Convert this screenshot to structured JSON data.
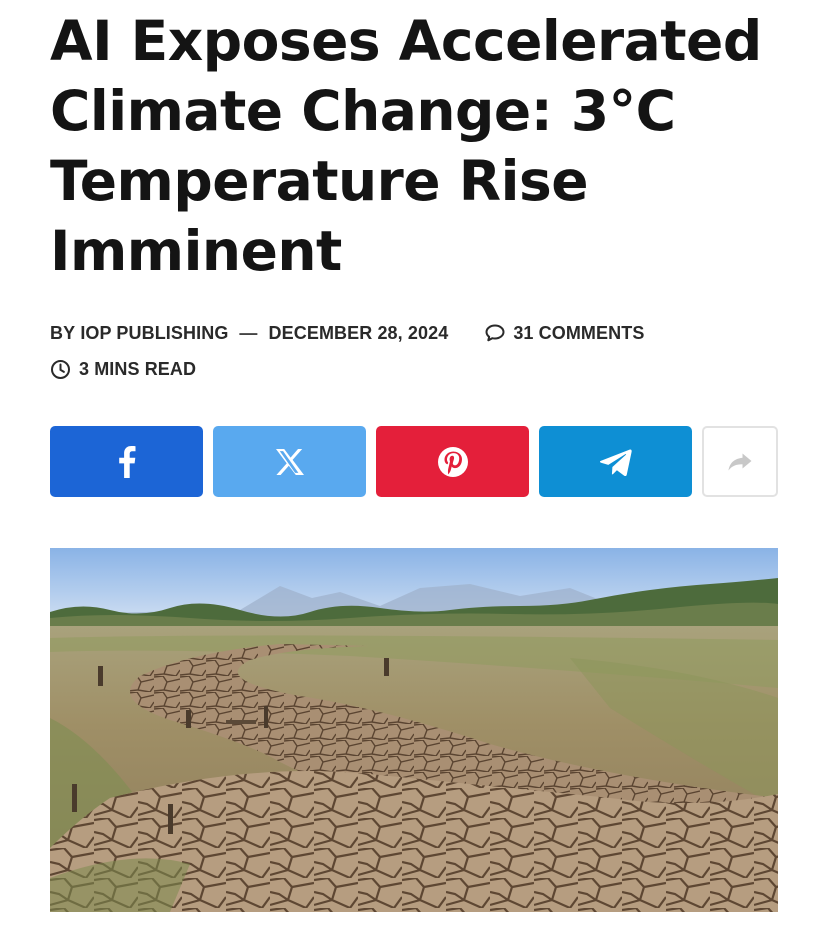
{
  "article": {
    "title": "AI Exposes Accelerated Climate Change: 3°C Temperature Rise Imminent",
    "byline_prefix": "BY",
    "author": "IOP PUBLISHING",
    "separator": "—",
    "date": "DECEMBER 28, 2024",
    "comments": "31 COMMENTS",
    "read_time": "3 MINS READ"
  },
  "share": {
    "buttons": [
      {
        "network": "facebook",
        "icon": "facebook-icon",
        "color": "#1c65d6"
      },
      {
        "network": "x",
        "icon": "x-icon",
        "color": "#59a9ef"
      },
      {
        "network": "pinterest",
        "icon": "pinterest-icon",
        "color": "#e41f3a"
      },
      {
        "network": "telegram",
        "icon": "telegram-icon",
        "color": "#0e8fd4"
      },
      {
        "network": "more",
        "icon": "share-arrow-icon",
        "color": "#ffffff"
      }
    ]
  },
  "hero_image": {
    "subject": "cracked-dry-riverbed"
  }
}
